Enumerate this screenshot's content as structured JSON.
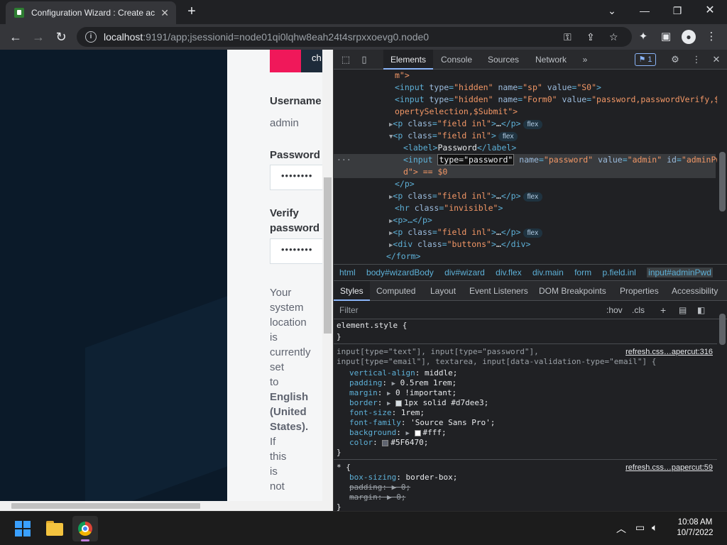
{
  "browser": {
    "tab_title": "Configuration Wizard : Create ac",
    "tab_close": "✕",
    "new_tab": "+",
    "url_host": "localhost",
    "url_path": ":9191/app;jsessionid=node01qi0lqhw8eah24t4srpxxoevg0.node0",
    "window_controls": [
      "minimize",
      "restore",
      "close"
    ],
    "toolbar_icons": [
      "key-icon",
      "share-icon",
      "star-icon",
      "extensions-icon",
      "sidebar-icon",
      "profile-icon",
      "menu-icon"
    ]
  },
  "page": {
    "top_button": "ch",
    "username_label": "Username",
    "username_value": "admin",
    "password_label": "Password",
    "password_value": "••••••••",
    "verify_label_1": "Verify",
    "verify_label_2": "password",
    "verify_value": "••••••••",
    "paragraph_words": [
      "Your",
      "system",
      "location",
      "is",
      "currently",
      "set",
      "to"
    ],
    "paragraph_bold": [
      "English",
      "(United",
      "States)."
    ],
    "paragraph_tail": [
      "If",
      "this",
      "is",
      "not"
    ]
  },
  "devtools": {
    "tabs": [
      "Elements",
      "Console",
      "Sources",
      "Network"
    ],
    "active_tab": "Elements",
    "more_tabs": "»",
    "issues_count": "1",
    "dom_lines": {
      "l1": "m\">",
      "l2_name": "sp",
      "l2_value": "S0",
      "l3_name": "Form0",
      "l3_value": "password,passwordVerify,$Pr",
      "l3b": "opertySelection,$Submit\">",
      "l4_class": "field inl",
      "l5_class": "field inl",
      "l6_label": "Password",
      "l7_type": "type=\"password\"",
      "l7_name": "password",
      "l7_value": "admin",
      "l7_id": "adminPw",
      "l7b": "d\"> == $0",
      "l8": "</p>",
      "l9_class": "field inl",
      "l10_class": "invisible",
      "l11": "<p>…</p>",
      "l12_class": "field inl",
      "l13_class": "buttons",
      "l14": "</form>",
      "flex": "flex"
    },
    "breadcrumbs": [
      "html",
      "body#wizardBody",
      "div#wizard",
      "div.flex",
      "div.main",
      "form",
      "p.field.inl",
      "input#adminPwd"
    ],
    "subtabs": [
      "Styles",
      "Computed",
      "Layout",
      "Event Listeners",
      "DOM Breakpoints",
      "Properties",
      "Accessibility"
    ],
    "filter_placeholder": "Filter",
    "hov": ":hov",
    "cls": ".cls",
    "styles": {
      "element_style": "element.style {",
      "close": "}",
      "rule1_sel_a": "input[type=\"text\"], input[type=\"password\"],",
      "rule1_sel_b": "input[type=\"email\"], textarea, input[data-validation-type=\"email\"] {",
      "rule1_src": "refresh.css…apercut:316",
      "props": [
        {
          "n": "vertical-align",
          "v": "middle;"
        },
        {
          "n": "padding",
          "v": "0.5rem 1rem;"
        },
        {
          "n": "margin",
          "v": "0 !important;"
        },
        {
          "n": "border",
          "v": "1px solid #d7dee3;"
        },
        {
          "n": "font-size",
          "v": "1rem;"
        },
        {
          "n": "font-family",
          "v": "'Source Sans Pro';"
        },
        {
          "n": "background",
          "v": "#fff;"
        },
        {
          "n": "color",
          "v": "#5F6470;"
        }
      ],
      "rule2_sel": "* {",
      "rule2_src": "refresh.css…papercut:59",
      "props2": [
        {
          "n": "box-sizing",
          "v": "border-box;"
        },
        {
          "n": "padding",
          "v": "0;"
        },
        {
          "n": "margin",
          "v": "0;"
        }
      ],
      "swatch_border": "#d7dee3",
      "swatch_bg": "#ffffff",
      "swatch_color": "#5F6470"
    }
  },
  "taskbar": {
    "time": "10:08 AM",
    "date": "10/7/2022",
    "apps": [
      "start-icon",
      "file-explorer-icon",
      "chrome-icon"
    ]
  }
}
